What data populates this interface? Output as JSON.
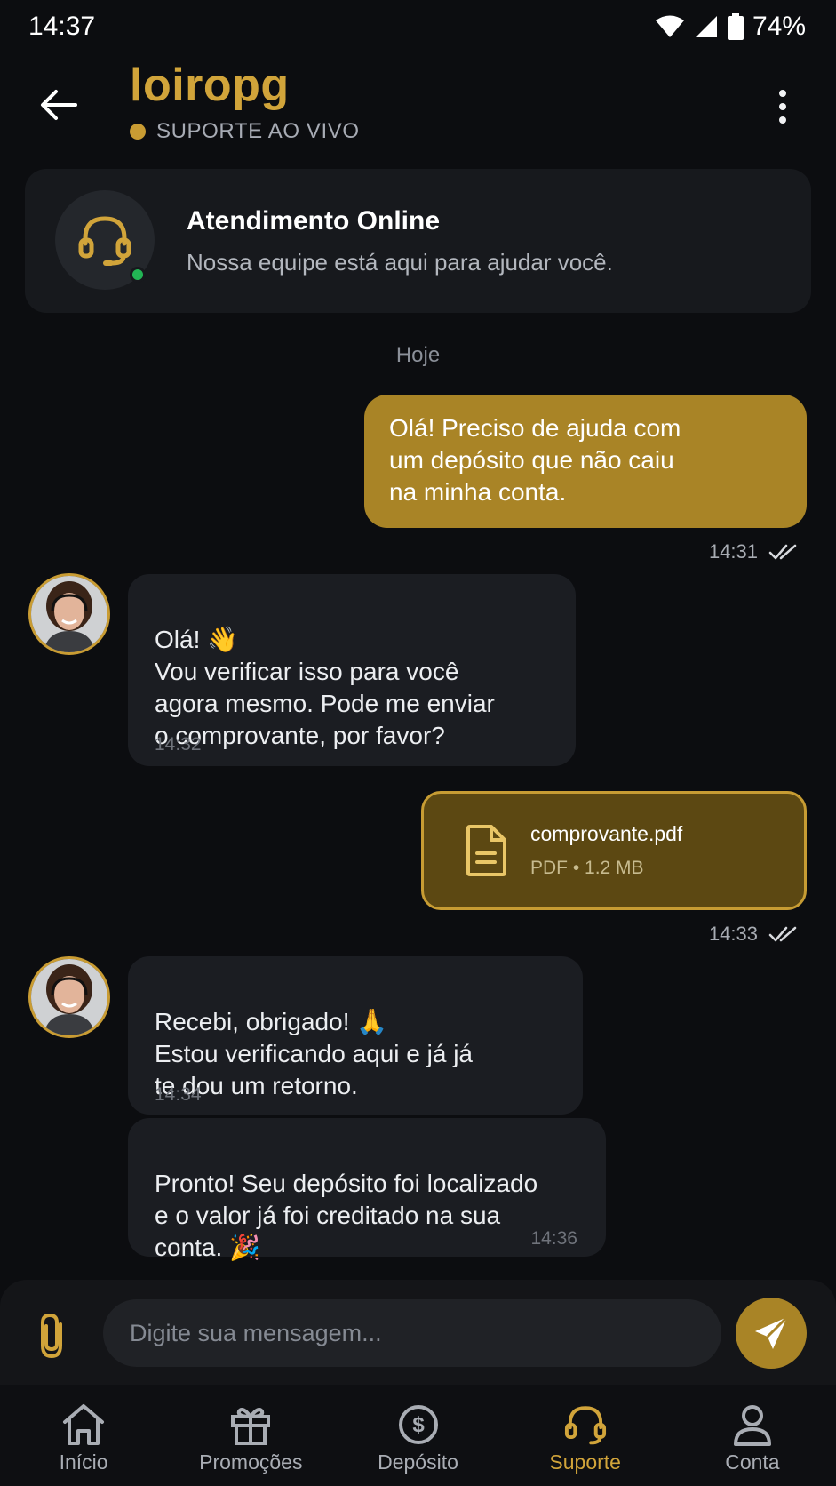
{
  "status": {
    "time": "14:37",
    "battery": "74%"
  },
  "header": {
    "brand": "loiropg",
    "live_label": "SUPORTE AO VIVO"
  },
  "support_card": {
    "title": "Atendimento Online",
    "subtitle": "Nossa equipe está aqui para ajudar você."
  },
  "day_divider": "Hoje",
  "messages": [
    {
      "from": "user",
      "text": "Olá! Preciso de ajuda com\num depósito que não caiu\nna minha conta.",
      "time": "14:31"
    },
    {
      "from": "agent",
      "text": "Olá! 👋\nVou verificar isso para você\nagora mesmo. Pode me enviar\no comprovante, por favor?",
      "time": "14:32"
    },
    {
      "from": "user",
      "file_name": "comprovante.pdf",
      "file_meta": "PDF • 1.2 MB",
      "time": "14:33"
    },
    {
      "from": "agent",
      "text": "Recebi, obrigado! 🙏\nEstou verificando aqui e já já\nte dou um retorno.",
      "time": "14:34"
    },
    {
      "from": "agent",
      "text": "Pronto! Seu depósito foi localizado\ne o valor já foi creditado na sua\nconta. 🎉",
      "time": "14:36"
    }
  ],
  "composer": {
    "placeholder": "Digite sua mensagem..."
  },
  "nav": [
    {
      "label": "Início",
      "icon": "home-icon"
    },
    {
      "label": "Promoções",
      "icon": "gift-icon"
    },
    {
      "label": "Depósito",
      "icon": "dollar-circle-icon"
    },
    {
      "label": "Suporte",
      "icon": "headset-icon",
      "active": true
    },
    {
      "label": "Conta",
      "icon": "user-icon"
    }
  ],
  "colors": {
    "accent": "#d1a43a",
    "user_bubble": "#a98426",
    "agent_bubble": "#1b1d22",
    "background": "#0c0d10",
    "online": "#22b454"
  }
}
